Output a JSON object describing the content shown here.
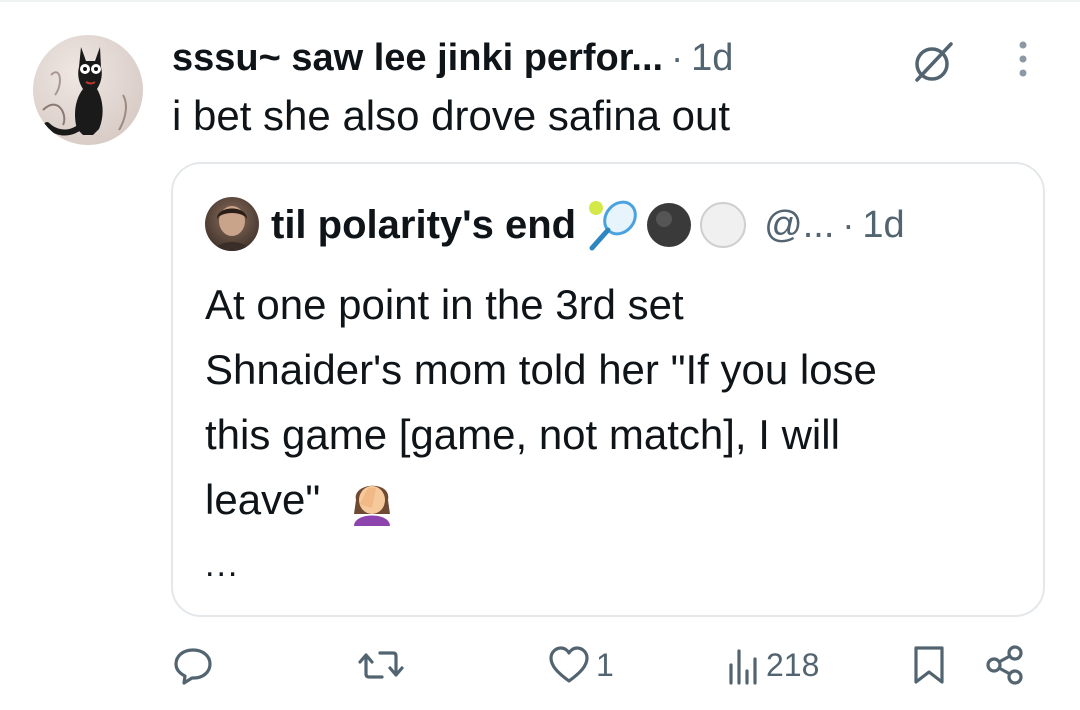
{
  "post": {
    "author": "sssu~ saw lee jinki perfor...",
    "separator": "·",
    "time": "1d",
    "text": "i bet she also drove safina out",
    "icons": {
      "grok": "grok-icon",
      "more": "more-vertical-icon",
      "avatar": "cat-avatar"
    }
  },
  "quote": {
    "author": "til polarity's end",
    "emojis": [
      "tennis-racket-emoji",
      "black-circle-emoji",
      "white-circle-emoji"
    ],
    "handle": "@...",
    "separator": "·",
    "time": "1d",
    "lines": [
      "At one point in the 3rd set",
      "Shnaider's mom told her \"If you lose",
      "this game [game, not match], I will",
      "leave\""
    ],
    "trailing_emoji": "facepalm-woman-emoji",
    "ellipsis": "..."
  },
  "actions": {
    "reply": {
      "icon": "reply-icon",
      "count": ""
    },
    "repost": {
      "icon": "repost-icon",
      "count": ""
    },
    "like": {
      "icon": "heart-icon",
      "count": "1"
    },
    "views": {
      "icon": "views-icon",
      "count": "218"
    },
    "bookmark": {
      "icon": "bookmark-icon"
    },
    "share": {
      "icon": "share-icon"
    }
  },
  "colors": {
    "text": "#0f1419",
    "secondary": "#536471",
    "border": "#e4e8ea"
  }
}
